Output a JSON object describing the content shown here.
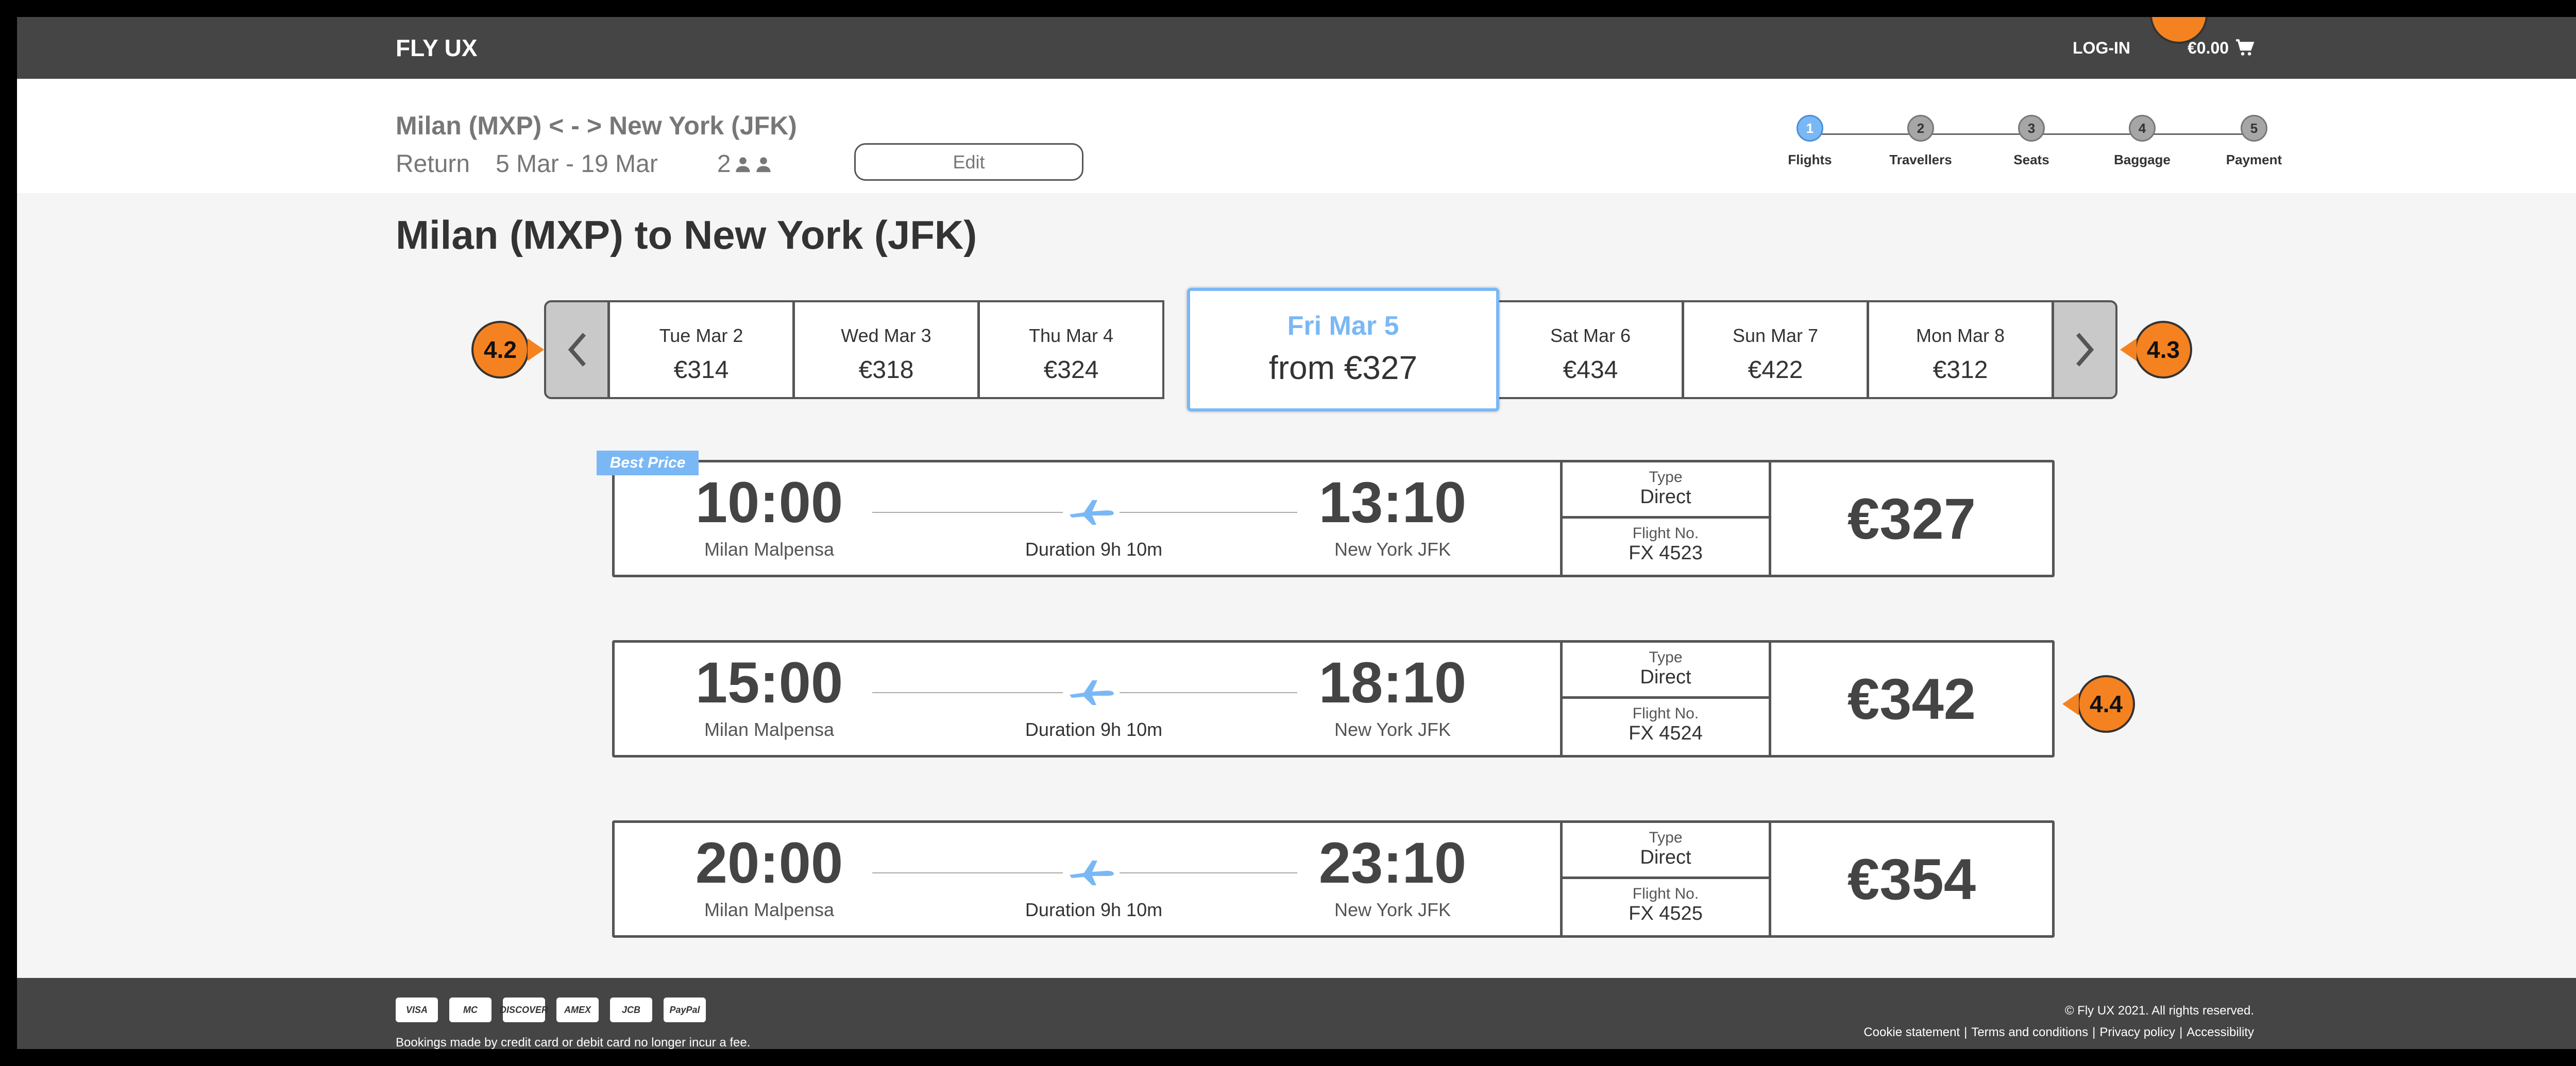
{
  "header": {
    "brand": "FLY UX",
    "login_label": "LOG-IN",
    "cart_total": "€0.00"
  },
  "summary": {
    "route": "Milan (MXP) < - > New York (JFK)",
    "trip_type": "Return",
    "dates": "5 Mar - 19 Mar",
    "passengers": "2",
    "edit_label": "Edit"
  },
  "steps": [
    {
      "number": "1",
      "label": "Flights",
      "active": true
    },
    {
      "number": "2",
      "label": "Travellers",
      "active": false
    },
    {
      "number": "3",
      "label": "Seats",
      "active": false
    },
    {
      "number": "4",
      "label": "Baggage",
      "active": false
    },
    {
      "number": "5",
      "label": "Payment",
      "active": false
    }
  ],
  "headline": "Milan (MXP) to New York (JFK)",
  "dates": [
    {
      "label": "Tue Mar 2",
      "price": "€314"
    },
    {
      "label": "Wed Mar 3",
      "price": "€318"
    },
    {
      "label": "Thu Mar 4",
      "price": "€324"
    },
    {
      "label": "Fri Mar 5",
      "price": "from €327",
      "selected": true
    },
    {
      "label": "Sat Mar 6",
      "price": "€434"
    },
    {
      "label": "Sun Mar 7",
      "price": "€422"
    },
    {
      "label": "Mon Mar 8",
      "price": "€312"
    }
  ],
  "best_price_label": "Best Price",
  "flights": [
    {
      "dep_time": "10:00",
      "dep_airport": "Milan Malpensa",
      "duration": "Duration 9h 10m",
      "arr_time": "13:10",
      "arr_airport": "New York JFK",
      "type_label": "Type",
      "type_value": "Direct",
      "flight_no_label": "Flight No.",
      "flight_no": "FX 4523",
      "price": "€327"
    },
    {
      "dep_time": "15:00",
      "dep_airport": "Milan Malpensa",
      "duration": "Duration 9h 10m",
      "arr_time": "18:10",
      "arr_airport": "New York JFK",
      "type_label": "Type",
      "type_value": "Direct",
      "flight_no_label": "Flight No.",
      "flight_no": "FX 4524",
      "price": "€342"
    },
    {
      "dep_time": "20:00",
      "dep_airport": "Milan Malpensa",
      "duration": "Duration 9h 10m",
      "arr_time": "23:10",
      "arr_airport": "New York JFK",
      "type_label": "Type",
      "type_value": "Direct",
      "flight_no_label": "Flight No.",
      "flight_no": "FX 4525",
      "price": "€354"
    }
  ],
  "footer": {
    "cards": [
      "VISA",
      "MC",
      "DISCOVER",
      "AMEX",
      "JCB",
      "PayPal"
    ],
    "note": "Bookings made by credit card or debit card no longer incur a fee.",
    "copyright": "© Fly UX 2021. All rights reserved.",
    "links": [
      "Cookie statement",
      "Terms and conditions",
      "Privacy policy",
      "Accessibility"
    ],
    "separator": "|"
  },
  "callouts": {
    "prev": "4.2",
    "next": "4.3",
    "flight": "4.4"
  },
  "colors": {
    "accent": "#7ab8f5",
    "bar": "#454545",
    "callout": "#f58220"
  },
  "icons": {
    "cart": "cart-icon",
    "person": "person-icon",
    "plane": "plane-icon",
    "prev": "chevron-left-icon",
    "next": "chevron-right-icon"
  }
}
